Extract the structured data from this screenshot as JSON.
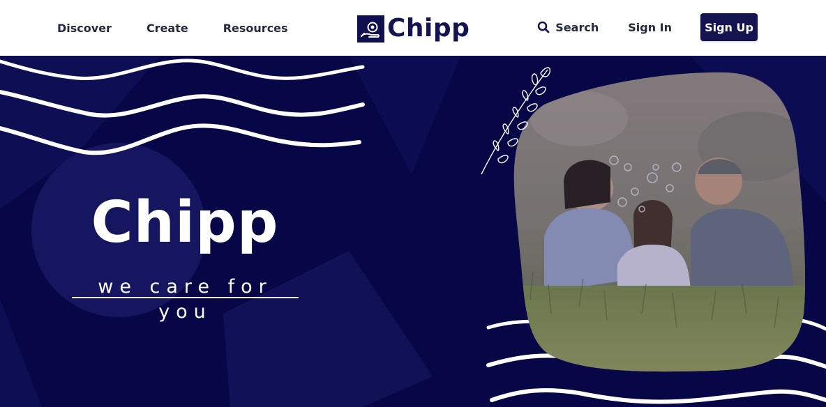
{
  "nav": {
    "discover": "Discover",
    "create": "Create",
    "resources": "Resources"
  },
  "brand": {
    "name": "Chipp",
    "color": "#141450"
  },
  "actions": {
    "search_label": "Search",
    "signin_label": "Sign In",
    "signup_label": "Sign Up"
  },
  "icons": {
    "search": "search-icon",
    "logo": "logo-mark-icon",
    "leaf": "leaf-branch-icon"
  },
  "hero": {
    "title": "Chipp",
    "tagline": "we care for you",
    "background_color": "#070747",
    "photo_description": "family-photo"
  }
}
